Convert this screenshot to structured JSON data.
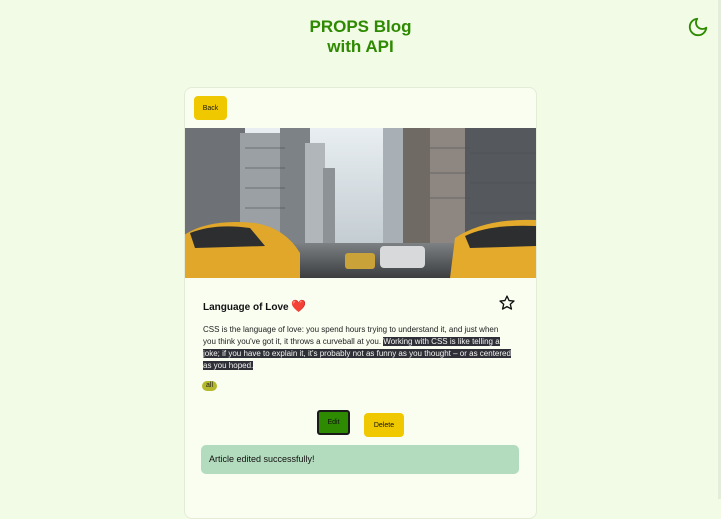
{
  "header": {
    "title_line1": "PROPS Blog",
    "title_line2": "with API"
  },
  "theme_toggle": {
    "icon": "moon-icon",
    "color": "#2e8a00"
  },
  "article": {
    "back_label": "Back",
    "image": "city-street-taxis-photo",
    "title": "Language of Love",
    "title_emoji": "❤️",
    "favorite_icon": "star-outline-icon",
    "body_plain": "CSS is the language of love: you spend hours trying to understand it, and just when you think you've got it, it throws a curveball at you. ",
    "body_selected": "Working with CSS is like telling a joke; if you have to explain it, it's probably not as funny as you thought – or as centered as you hoped.",
    "tag": "all",
    "edit_label": "Edit",
    "delete_label": "Delete"
  },
  "toast": {
    "message": "Article edited successfully!"
  },
  "colors": {
    "background": "#f1fbe6",
    "accent_green": "#2e8a00",
    "button_yellow": "#f0c800",
    "toast_bg": "#b3dbbd",
    "tag_bg": "#b5b82a"
  }
}
